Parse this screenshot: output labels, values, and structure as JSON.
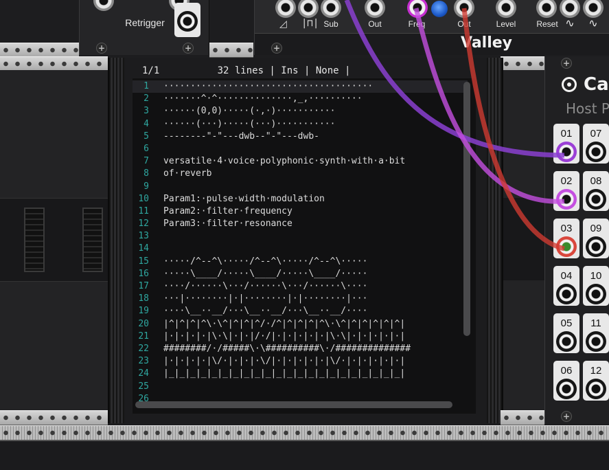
{
  "top_module": {
    "retrigger_label": "Retrigger",
    "jack_labels": [
      "Sub",
      "Out",
      "Freq",
      "Out",
      "Level",
      "Reset"
    ],
    "wave_labels": [
      "∿",
      "∿"
    ],
    "brand": "Valley"
  },
  "editor": {
    "status": "1/1          32 lines | Ins | None |",
    "line_numbers": [
      "1",
      "2",
      "3",
      "4",
      "5",
      "6",
      "7",
      "8",
      "9",
      "10",
      "11",
      "12",
      "13",
      "14",
      "15",
      "16",
      "17",
      "18",
      "19",
      "20",
      "21",
      "22",
      "23",
      "24",
      "25",
      "26"
    ],
    "lines": [
      "·······································",
      "·······^·^··············,_,··········",
      "······(0,0)·····(·,·)···········",
      "······(···)·····(···)···········",
      "--------\"-\"---dwb--\"-\"---dwb-",
      "",
      "versatile·4·voice·polyphonic·synth·with·a·bit",
      "of·reverb",
      "",
      "Param1:·pulse·width·modulation",
      "Param2:·filter·frequency",
      "Param3:·filter·resonance",
      "",
      "",
      "·····/^--^\\·····/^--^\\·····/^--^\\·····",
      "·····\\____/·····\\____/·····\\____/·····",
      "····/······\\···/······\\···/······\\····",
      "···|········|·|········|·|········|···",
      "····\\__··__/···\\__··__/···\\__··__/····",
      "|^|^|^|^\\·\\^|^|^|^/·/^|^|^|^|^\\·\\^|^|^|^|^|^|",
      "|·|·|·|·|\\·\\|·|·|/·/|·|·|·|·|·|\\·\\|·|·|·|·|·|",
      "########/·/#####\\·\\##########\\·/##############",
      "|·|·|·|·|\\/·|·|·|·\\/|·|·|·|·|·|\\/·|·|·|·|·|·|",
      "|_|_|_|_|_|_|_|_|_|_|_|_|_|_|_|_|_|_|_|_|_|_|",
      "",
      ""
    ]
  },
  "host_module": {
    "title": "Ca",
    "subtitle": "Host P",
    "jacks_left": [
      "01",
      "02",
      "03",
      "04",
      "05",
      "06"
    ],
    "jacks_right": [
      "07",
      "08",
      "09",
      "10",
      "11",
      "12"
    ]
  },
  "colors": {
    "cable_purple": "#9b3fd6",
    "cable_magenta": "#c44fe0",
    "cable_red": "#d9473c",
    "line_number": "#2fa7a0"
  }
}
